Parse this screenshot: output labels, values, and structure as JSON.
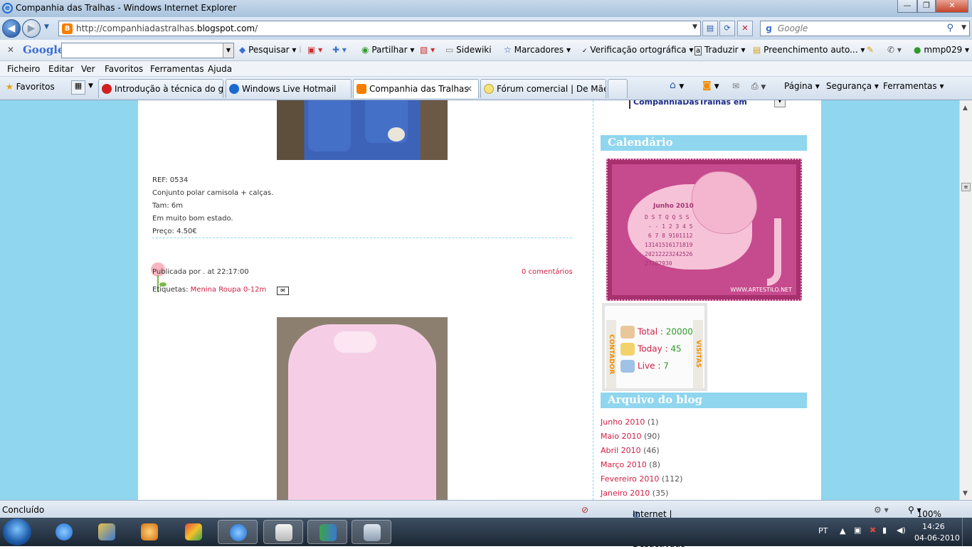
{
  "window": {
    "title": "Companhia das Tralhas - Windows Internet Explorer",
    "minimize": "—",
    "maximize": "❐",
    "close": "✕"
  },
  "address": {
    "url_prefix": "http://companhiadastralhas.",
    "url_domain": "blogspot.com",
    "url_suffix": "/",
    "search_placeholder": "Google"
  },
  "google_toolbar": {
    "logo": "Google",
    "items": [
      "Pesquisar",
      "Partilhar",
      "Sidewiki",
      "Marcadores",
      "Verificação ortográfica",
      "Traduzir",
      "Preenchimento auto...",
      "mmp029"
    ]
  },
  "menu": [
    "Ficheiro",
    "Editar",
    "Ver",
    "Favoritos",
    "Ferramentas",
    "Ajuda"
  ],
  "favorites": {
    "label": "Favoritos",
    "tabs": [
      {
        "label": "Introdução à técnica do g...",
        "color": "#d02020"
      },
      {
        "label": "Windows Live Hotmail",
        "color": "#1b6ad1"
      },
      {
        "label": "Companhia das Tralhas",
        "color": "#f57d00"
      },
      {
        "label": "Fórum comercial | De Mãe...",
        "color": "#f4e27a"
      }
    ],
    "commands": [
      "Página",
      "Segurança",
      "Ferramentas"
    ]
  },
  "post": {
    "lines": [
      "REF: 0534",
      "Conjunto polar camisola + calças.",
      "Tam: 6m",
      "Em muito bom estado.",
      "Preço: 4.50€"
    ],
    "published": "Publicada por . at 22:17:00",
    "comments": "0 comentários",
    "labels_prefix": "Etiquetas: ",
    "labels_link": "Menina Roupa 0-12m"
  },
  "sidebar": {
    "top_cut_text": "CompanhiaDasTralhas em",
    "calendar_title": "Calendário",
    "calendar": {
      "month": "Junho 2010",
      "grid": "D S T Q Q S S\n - - 1 2 3 4 5\n 6 7 8 9101112\n13141516171819\n20212223242526\n27282930",
      "url": "WWW.ARTESTILO.NET"
    },
    "counter": {
      "left_vertical": "CONTADOR",
      "right_vertical": "VISITAS",
      "total_label": "Total : ",
      "total_value": "20000",
      "today_label": "Today : ",
      "today_value": "45",
      "live_label": "Live : ",
      "live_value": "7"
    },
    "archive_title": "Arquivo do blog",
    "archive": [
      {
        "month": "Junho 2010",
        "count": " (1)"
      },
      {
        "month": "Maio 2010",
        "count": " (90)"
      },
      {
        "month": "Abril 2010",
        "count": " (46)"
      },
      {
        "month": "Março 2010",
        "count": " (8)"
      },
      {
        "month": "Fevereiro 2010",
        "count": " (112)"
      },
      {
        "month": "Janeiro 2010",
        "count": " (35)"
      }
    ]
  },
  "status": {
    "text": "Concluído",
    "zone": "Internet | Modo Protegido: Desactivado",
    "zoom": "100%"
  },
  "taskbar": {
    "lang": "PT",
    "time": "14:26",
    "date": "04-06-2010"
  },
  "colors": {
    "page_bg": "#8fd6ee",
    "link": "#d01f45",
    "sidebar_header": "#8fd6ee"
  }
}
